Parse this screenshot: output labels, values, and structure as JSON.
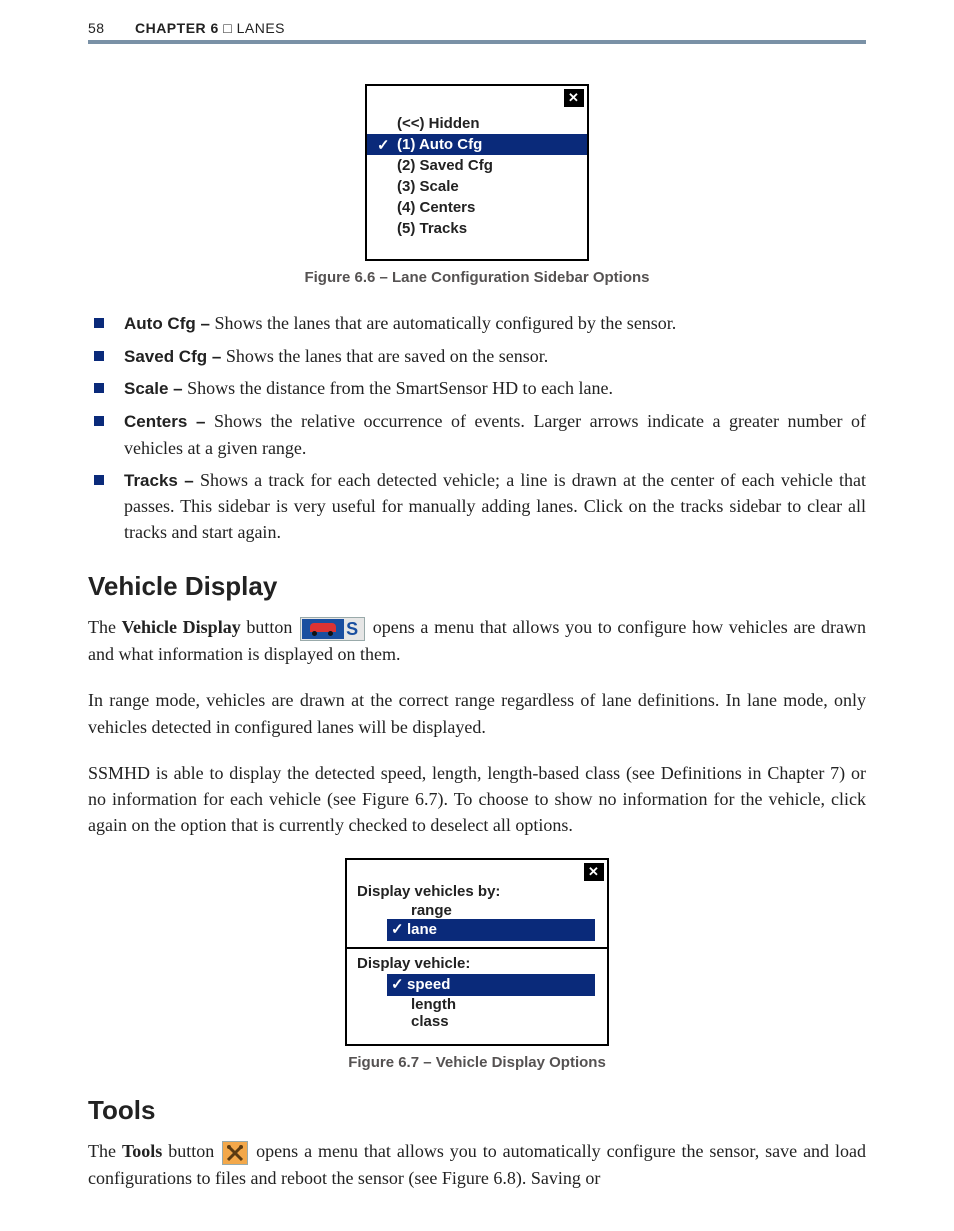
{
  "header": {
    "page_number": "58",
    "chapter_label": "CHAPTER 6",
    "chapter_separator": "   □   ",
    "chapter_title": "LANES"
  },
  "fig66": {
    "items": [
      {
        "label": "(<<) Hidden",
        "active": false,
        "checked": false
      },
      {
        "label": "(1) Auto Cfg",
        "active": true,
        "checked": true
      },
      {
        "label": "(2) Saved Cfg",
        "active": false,
        "checked": false
      },
      {
        "label": "(3) Scale",
        "active": false,
        "checked": false
      },
      {
        "label": "(4) Centers",
        "active": false,
        "checked": false
      },
      {
        "label": "(5) Tracks",
        "active": false,
        "checked": false
      }
    ],
    "caption": "Figure 6.6 – Lane Configuration Sidebar Options"
  },
  "bullets": [
    {
      "term": "Auto Cfg –",
      "desc": " Shows the lanes that are automatically configured by the sensor."
    },
    {
      "term": "Saved Cfg –",
      "desc": " Shows the lanes that are saved on the sensor."
    },
    {
      "term": "Scale –",
      "desc": " Shows the distance from the SmartSensor HD to each lane."
    },
    {
      "term": "Centers –",
      "desc": " Shows the relative occurrence of events. Larger arrows indicate a greater number of vehicles at a given range."
    },
    {
      "term": "Tracks –",
      "desc": " Shows a track for each detected vehicle; a line is drawn at the center of each vehicle that passes. This sidebar is very useful for manually adding lanes. Click on the tracks sidebar to clear all tracks and start again."
    }
  ],
  "vehicle_display": {
    "heading": "Vehicle Display",
    "para1_a": "The ",
    "para1_b_bold": "Vehicle Display",
    "para1_c": " button ",
    "button_letter": "S",
    "para1_d": " opens a menu that allows you to configure how vehicles are drawn and what information is displayed on them.",
    "para2": "In range mode, vehicles are drawn at the correct range regardless of lane definitions. In lane mode, only vehicles detected in configured lanes will be displayed.",
    "para3": "SSMHD is able to display the detected speed, length, length-based class (see Definitions in Chapter 7) or no information for each vehicle (see Figure 6.7). To choose to show no information for the vehicle, click again on the option that is currently checked to deselect all options."
  },
  "fig67": {
    "group1_heading": "Display vehicles by:",
    "group1": {
      "range": "range",
      "lane": "lane"
    },
    "group2_heading": "Display vehicle:",
    "group2": {
      "speed": "speed",
      "length": "length",
      "cls": "class"
    },
    "caption": "Figure 6.7 – Vehicle Display Options"
  },
  "tools": {
    "heading": "Tools",
    "para_a": "The ",
    "para_b_bold": "Tools",
    "para_c": " button ",
    "para_d": " opens a menu that allows you to automatically configure the sensor, save and load configurations to files and reboot the sensor (see Figure 6.8). Saving or"
  }
}
